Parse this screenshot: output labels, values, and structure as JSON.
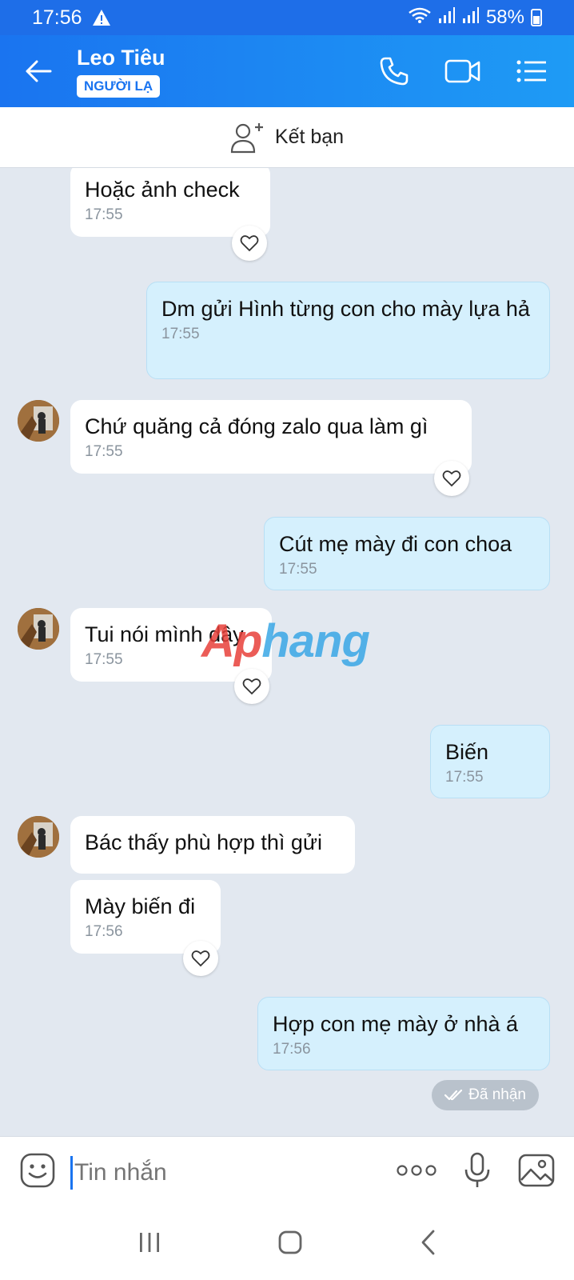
{
  "status_bar": {
    "time": "17:56",
    "battery": "58%"
  },
  "header": {
    "name": "Leo Tiêu",
    "badge": "NGƯỜI LẠ"
  },
  "add_friend": {
    "label": "Kết bạn"
  },
  "messages": [
    {
      "dir": "in",
      "text": "Hoặc ảnh check",
      "time": "17:55"
    },
    {
      "dir": "out",
      "text": "Dm gửi Hình từng con cho mày lựa hả",
      "time": "17:55"
    },
    {
      "dir": "in",
      "text": "Chứ quăng cả đóng zalo qua làm gì",
      "time": "17:55"
    },
    {
      "dir": "out",
      "text": "Cút mẹ mày đi con choa",
      "time": "17:55"
    },
    {
      "dir": "in",
      "text": "Tui nói mình dây",
      "time": "17:55"
    },
    {
      "dir": "out",
      "text": "Biến",
      "time": "17:55"
    },
    {
      "dir": "in",
      "text": "Bác thấy phù hợp thì gửi"
    },
    {
      "dir": "in",
      "text": "Mày biến đi",
      "time": "17:56"
    },
    {
      "dir": "out",
      "text": "Hợp con mẹ mày ở nhà á",
      "time": "17:56"
    }
  ],
  "watermark": {
    "part1": "Ap",
    "part2": "hang"
  },
  "receipt": "Đã nhận",
  "input": {
    "placeholder": "Tin nhắn"
  },
  "icons": [
    "warning-icon",
    "wifi-icon",
    "signal-icon",
    "battery-icon",
    "back-arrow-icon",
    "phone-icon",
    "video-call-icon",
    "menu-icon",
    "add-friend-icon",
    "heart-icon",
    "double-check-icon",
    "emoji-icon",
    "more-icon",
    "microphone-icon",
    "image-icon",
    "nav-recents-icon",
    "nav-home-icon",
    "nav-back-icon"
  ],
  "colors": {
    "header_start": "#1a74f0",
    "header_end": "#1e9bf5",
    "outgoing_bubble": "#d5f0fd",
    "chat_background": "#e2e8f0"
  }
}
